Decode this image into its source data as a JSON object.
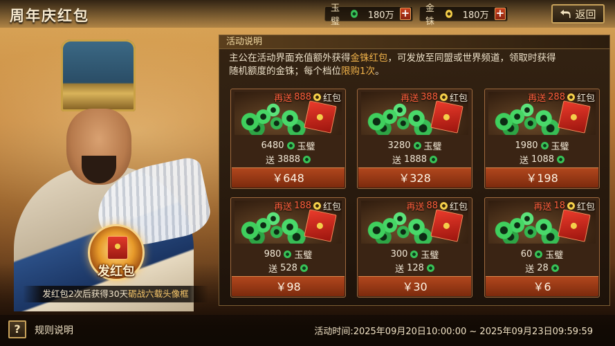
{
  "header": {
    "title": "周年庆红包",
    "back_label": "返回"
  },
  "resources": [
    {
      "name": "玉璧",
      "value": "180万",
      "plus": "+",
      "icon": "jade-coin-icon"
    },
    {
      "name": "金铢",
      "value": "180万",
      "plus": "+",
      "icon": "gold-coin-icon"
    }
  ],
  "description": {
    "heading": "活动说明",
    "line1_a": "主公在活动界面充值额外获得",
    "line1_hl": "金铢红包",
    "line1_b": "，可发放至同盟或世界频道，领取时获得",
    "line2_a": "随机额度的金铢；每个档位",
    "line2_hl": "限购1次",
    "line2_b": "。"
  },
  "packs": [
    {
      "bonus_prefix": "再送",
      "bonus_amount": "888",
      "bonus_unit": "红包",
      "amount": "6480",
      "currency": "玉璧",
      "gift_prefix": "送",
      "gift_amount": "3888",
      "price": "￥648"
    },
    {
      "bonus_prefix": "再送",
      "bonus_amount": "388",
      "bonus_unit": "红包",
      "amount": "3280",
      "currency": "玉璧",
      "gift_prefix": "送",
      "gift_amount": "1888",
      "price": "￥328"
    },
    {
      "bonus_prefix": "再送",
      "bonus_amount": "288",
      "bonus_unit": "红包",
      "amount": "1980",
      "currency": "玉璧",
      "gift_prefix": "送",
      "gift_amount": "1088",
      "price": "￥198"
    },
    {
      "bonus_prefix": "再送",
      "bonus_amount": "188",
      "bonus_unit": "红包",
      "amount": "980",
      "currency": "玉璧",
      "gift_prefix": "送",
      "gift_amount": "528",
      "price": "￥98"
    },
    {
      "bonus_prefix": "再送",
      "bonus_amount": "88",
      "bonus_unit": "红包",
      "amount": "300",
      "currency": "玉璧",
      "gift_prefix": "送",
      "gift_amount": "128",
      "price": "￥30"
    },
    {
      "bonus_prefix": "再送",
      "bonus_amount": "18",
      "bonus_unit": "红包",
      "amount": "60",
      "currency": "玉璧",
      "gift_prefix": "送",
      "gift_amount": "28",
      "price": "￥6"
    }
  ],
  "send_button": {
    "label": "发红包"
  },
  "promo": {
    "text_a": "发红包2次后获得30天",
    "text_hl": "砺战六载头像框"
  },
  "footer": {
    "help_glyph": "?",
    "rules_label": "规则说明",
    "activity_time": "活动时间:2025年09月20日10:00:00 ~ 2025年09月23日09:59:59"
  },
  "colors": {
    "jade": "#3fcf5d",
    "gold": "#f4cf4a",
    "highlight": "#f0b24a",
    "bonus_red": "#ff5f3c",
    "price_button": "#a0401a"
  }
}
